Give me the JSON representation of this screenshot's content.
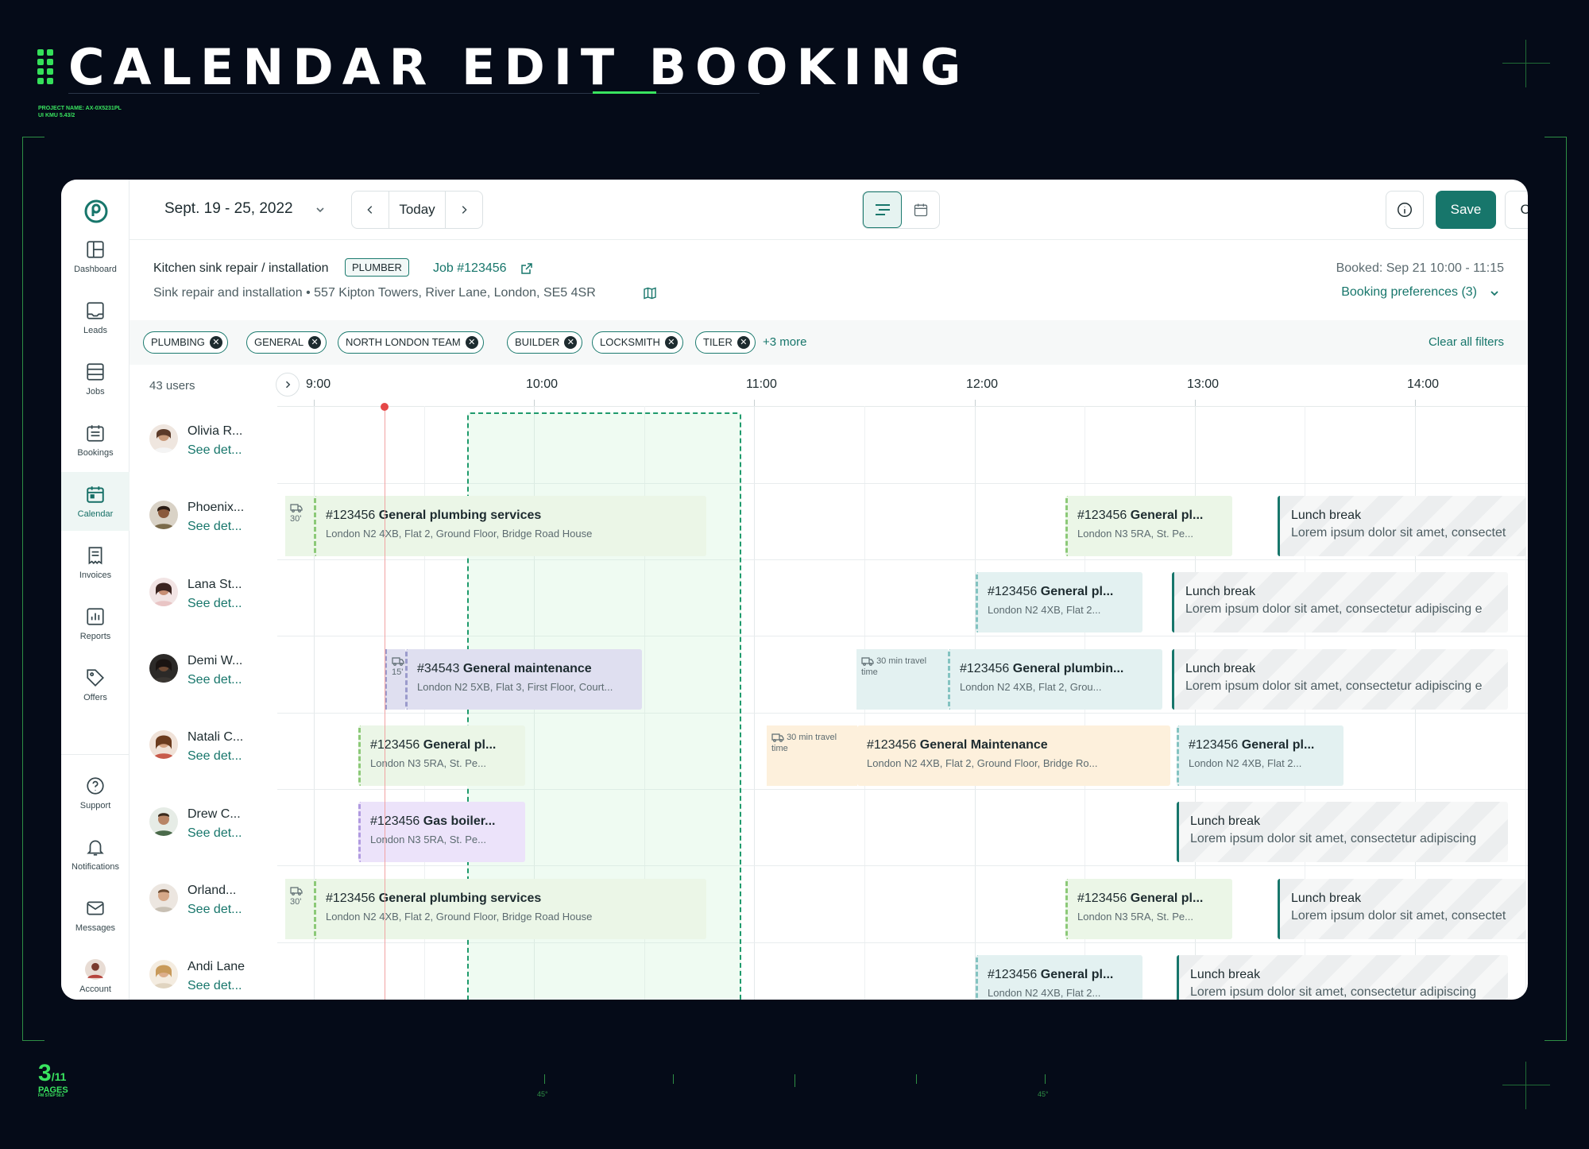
{
  "hero": {
    "title": "CALENDAR EDIT BOOKING",
    "project_line1": "PROJECT NAME: AX-0X5231PL",
    "project_line2": "UI KMU 5.43/2",
    "page_current": "3",
    "page_total": "/11",
    "page_label": "PAGES",
    "page_sub": "FM STEP 50.5",
    "ruler_left": "45°",
    "ruler_right": "45°"
  },
  "sidebar": {
    "items": [
      {
        "label": "Dashboard",
        "icon": "dashboard-icon"
      },
      {
        "label": "Leads",
        "icon": "leads-icon"
      },
      {
        "label": "Jobs",
        "icon": "jobs-icon"
      },
      {
        "label": "Bookings",
        "icon": "bookings-icon"
      },
      {
        "label": "Calendar",
        "icon": "calendar-icon",
        "active": true
      },
      {
        "label": "Invoices",
        "icon": "invoices-icon"
      },
      {
        "label": "Reports",
        "icon": "reports-icon"
      },
      {
        "label": "Offers",
        "icon": "offers-icon"
      },
      {
        "label": "Support",
        "icon": "support-icon"
      },
      {
        "label": "Notifications",
        "icon": "bell-icon"
      },
      {
        "label": "Messages",
        "icon": "mail-icon"
      },
      {
        "label": "Account",
        "icon": "avatar"
      }
    ]
  },
  "topbar": {
    "date_range": "Sept. 19 - 25, 2022",
    "today_label": "Today",
    "save_label": "Save",
    "cancel_label": "Cancel"
  },
  "job": {
    "title": "Kitchen sink repair / installation",
    "tag": "PLUMBER",
    "link": "Job #123456",
    "subtitle": "Sink repair and installation  •  557 Kipton Towers, River Lane, London, SE5 4SR",
    "booked": "Booked: Sep 21  10:00 - 11:15",
    "preferences": "Booking preferences (3)"
  },
  "filters": {
    "chips": [
      "PLUMBING",
      "GENERAL",
      "NORTH LONDON TEAM",
      "BUILDER",
      "LOCKSMITH",
      "TILER"
    ],
    "more": "+3 more",
    "clear": "Clear all filters"
  },
  "schedule": {
    "users_count": "43 users",
    "hours": [
      "9:00",
      "10:00",
      "11:00",
      "12:00",
      "13:00",
      "14:00"
    ],
    "users": [
      {
        "name": "Olivia R...",
        "link": "See det..."
      },
      {
        "name": "Phoenix...",
        "link": "See det..."
      },
      {
        "name": "Lana St...",
        "link": "See det..."
      },
      {
        "name": "Demi W...",
        "link": "See det..."
      },
      {
        "name": "Natali C...",
        "link": "See det..."
      },
      {
        "name": "Drew C...",
        "link": "See det..."
      },
      {
        "name": "Orland...",
        "link": "See det..."
      },
      {
        "name": "Andi Lane",
        "link": "See det..."
      }
    ],
    "travel": {
      "t30": "30'",
      "t15": "15'",
      "t30_text_a": "30 min travel",
      "t30_text_b": "time"
    },
    "blocks": {
      "r1a_id": "#123456",
      "r1a_title": "General plumbing services",
      "r1a_sub": "London N2 4XB, Flat 2, Ground Floor, Bridge Road House",
      "r1b_id": "#123456",
      "r1b_title": "General pl...",
      "r1b_sub": "London N3 5RA, St. Pe...",
      "r1c_title": "Lunch break",
      "r1c_sub": "Lorem ipsum dolor sit amet, consectet",
      "r2a_id": "#123456",
      "r2a_title": "General pl...",
      "r2a_sub": "London N2 4XB, Flat 2...",
      "r2b_title": "Lunch break",
      "r2b_sub": "Lorem ipsum dolor sit amet, consectetur adipiscing e",
      "r3a_id": "#34543",
      "r3a_title": "General maintenance",
      "r3a_sub": "London N2 5XB, Flat 3, First Floor, Court...",
      "r3b_id": "#123456",
      "r3b_title": "General plumbin...",
      "r3b_sub": "London N2 4XB, Flat 2, Grou...",
      "r3c_title": "Lunch break",
      "r3c_sub": "Lorem ipsum dolor sit amet, consectetur adipiscing e",
      "r4a_id": "#123456",
      "r4a_title": "General pl...",
      "r4a_sub": "London N3 5RA, St. Pe...",
      "r4b_id": "#123456",
      "r4b_title": "General Maintenance",
      "r4b_sub": "London N2 4XB, Flat 2, Ground Floor, Bridge Ro...",
      "r4c_id": "#123456",
      "r4c_title": "General pl...",
      "r4c_sub": "London N2 4XB, Flat 2...",
      "r5a_id": "#123456",
      "r5a_title": "Gas boiler...",
      "r5a_sub": "London N3 5RA, St. Pe...",
      "r5b_title": "Lunch break",
      "r5b_sub": "Lorem ipsum dolor sit amet, consectetur adipiscing",
      "r6a_id": "#123456",
      "r6a_title": "General plumbing services",
      "r6a_sub": "London N2 4XB, Flat 2, Ground Floor, Bridge Road House",
      "r6b_id": "#123456",
      "r6b_title": "General pl...",
      "r6b_sub": "London N3 5RA, St. Pe...",
      "r6c_title": "Lunch break",
      "r6c_sub": "Lorem ipsum dolor sit amet, consectet",
      "r7a_id": "#123456",
      "r7a_title": "General pl...",
      "r7a_sub": "London N2 4XB, Flat 2...",
      "r7b_title": "Lunch break",
      "r7b_sub": "Lorem ipsum dolor sit amet, consectetur adipiscing"
    }
  }
}
